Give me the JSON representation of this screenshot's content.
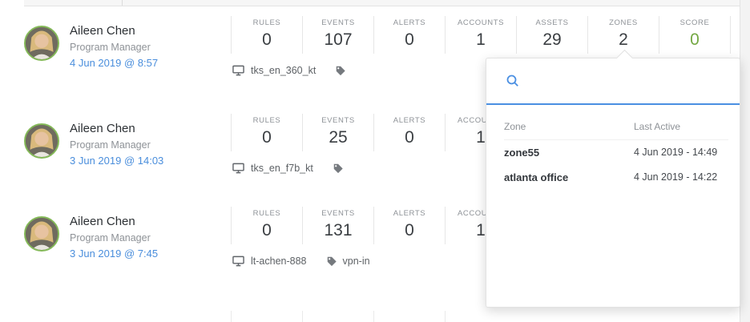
{
  "rows": [
    {
      "name": "Aileen Chen",
      "role": "Program Manager",
      "last_seen": "4 Jun 2019 @ 8:57",
      "device": "tks_en_360_kt",
      "tag": "",
      "stats": [
        {
          "label": "RULES",
          "value": "0"
        },
        {
          "label": "EVENTS",
          "value": "107"
        },
        {
          "label": "ALERTS",
          "value": "0"
        },
        {
          "label": "ACCOUNTS",
          "value": "1"
        },
        {
          "label": "ASSETS",
          "value": "29"
        },
        {
          "label": "ZONES",
          "value": "2"
        },
        {
          "label": "SCORE",
          "value": "0"
        }
      ]
    },
    {
      "name": "Aileen Chen",
      "role": "Program Manager",
      "last_seen": "3 Jun 2019 @ 14:03",
      "device": "tks_en_f7b_kt",
      "tag": "",
      "stats": [
        {
          "label": "RULES",
          "value": "0"
        },
        {
          "label": "EVENTS",
          "value": "25"
        },
        {
          "label": "ALERTS",
          "value": "0"
        },
        {
          "label": "ACCOUNTS",
          "value": "1"
        }
      ]
    },
    {
      "name": "Aileen Chen",
      "role": "Program Manager",
      "last_seen": "3 Jun 2019 @ 7:45",
      "device": "lt-achen-888",
      "tag": "vpn-in",
      "stats": [
        {
          "label": "RULES",
          "value": "0"
        },
        {
          "label": "EVENTS",
          "value": "131"
        },
        {
          "label": "ALERTS",
          "value": "0"
        },
        {
          "label": "ACCOUNTS",
          "value": "1"
        }
      ]
    }
  ],
  "zones_popup": {
    "search_placeholder": "",
    "columns": {
      "zone": "Zone",
      "last_active": "Last Active"
    },
    "zones": [
      {
        "zone": "zone55",
        "last_active": "4 Jun 2019 - 14:49"
      },
      {
        "zone": "atlanta office",
        "last_active": "4 Jun 2019 - 14:22"
      }
    ]
  },
  "colors": {
    "score_green": "#74a843",
    "link_blue": "#4a8edc",
    "accent_blue": "#4a8fe2",
    "avatar_ring_green": "#84b958"
  }
}
